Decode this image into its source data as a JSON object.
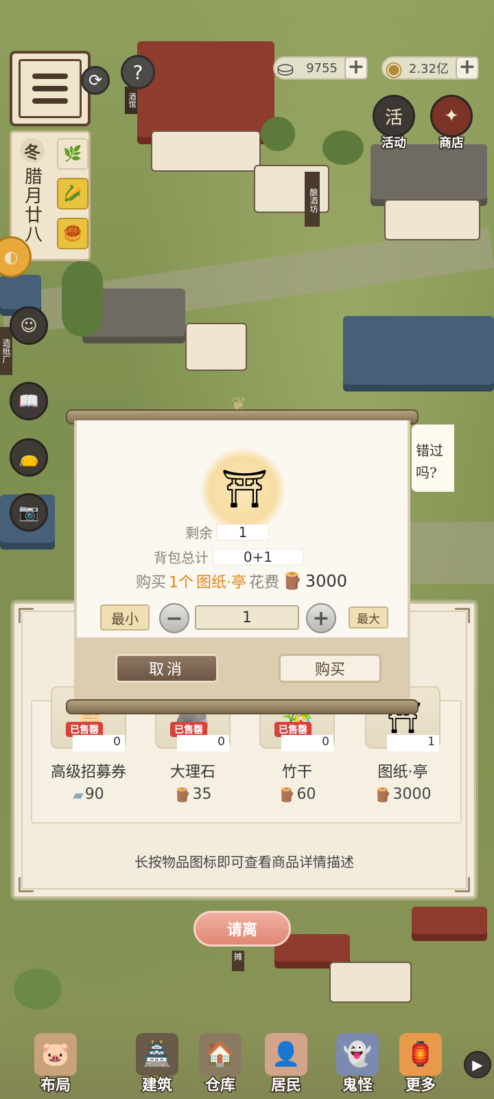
{
  "hud": {
    "silver": "9755",
    "coins": "2.32亿",
    "help_icon": "?",
    "tavern_label": "酒馆",
    "season": "冬",
    "date": "腊月廿八",
    "activity_label": "活动",
    "shop_label": "商店",
    "brewery_label": "酿酒坊",
    "papermill_label": "造纸厂",
    "stall_label": "摊"
  },
  "speech": {
    "line1": "错过",
    "line2": "吗?"
  },
  "dialog": {
    "remaining_label": "剩余",
    "remaining_value": "1",
    "bag_total_label": "背包总计",
    "bag_total_value": "0+1",
    "buy_prefix": "购买",
    "buy_count": "1个",
    "buy_item": "图纸·亭",
    "cost_label": "花费",
    "cost_value": "3000",
    "min_label": "最小",
    "max_label": "最大",
    "minus": "−",
    "plus": "+",
    "quantity": "1",
    "cancel_label": "取消",
    "buy_label": "购买"
  },
  "shop": {
    "items": [
      {
        "name": "高级招募券",
        "price": "90",
        "count": "0",
        "sold": "已售罄",
        "currency_icon": "ticket-icon"
      },
      {
        "name": "大理石",
        "price": "35",
        "count": "0",
        "sold": "已售罄",
        "currency_icon": "wood-icon"
      },
      {
        "name": "竹干",
        "price": "60",
        "count": "0",
        "sold": "已售罄",
        "currency_icon": "wood-icon"
      },
      {
        "name": "图纸·亭",
        "price": "3000",
        "count": "1",
        "sold": "",
        "currency_icon": "wood-icon"
      }
    ],
    "hint": "长按物品图标即可查看商品详情描述",
    "leave_label": "请离"
  },
  "nav": {
    "layout": "布局",
    "build": "建筑",
    "warehouse": "仓库",
    "residents": "居民",
    "ghost": "鬼怪",
    "more": "更多"
  },
  "colors": {
    "accent_orange": "#e0841a",
    "sold_red": "#d8403a",
    "leave_pink": "#e18776"
  }
}
